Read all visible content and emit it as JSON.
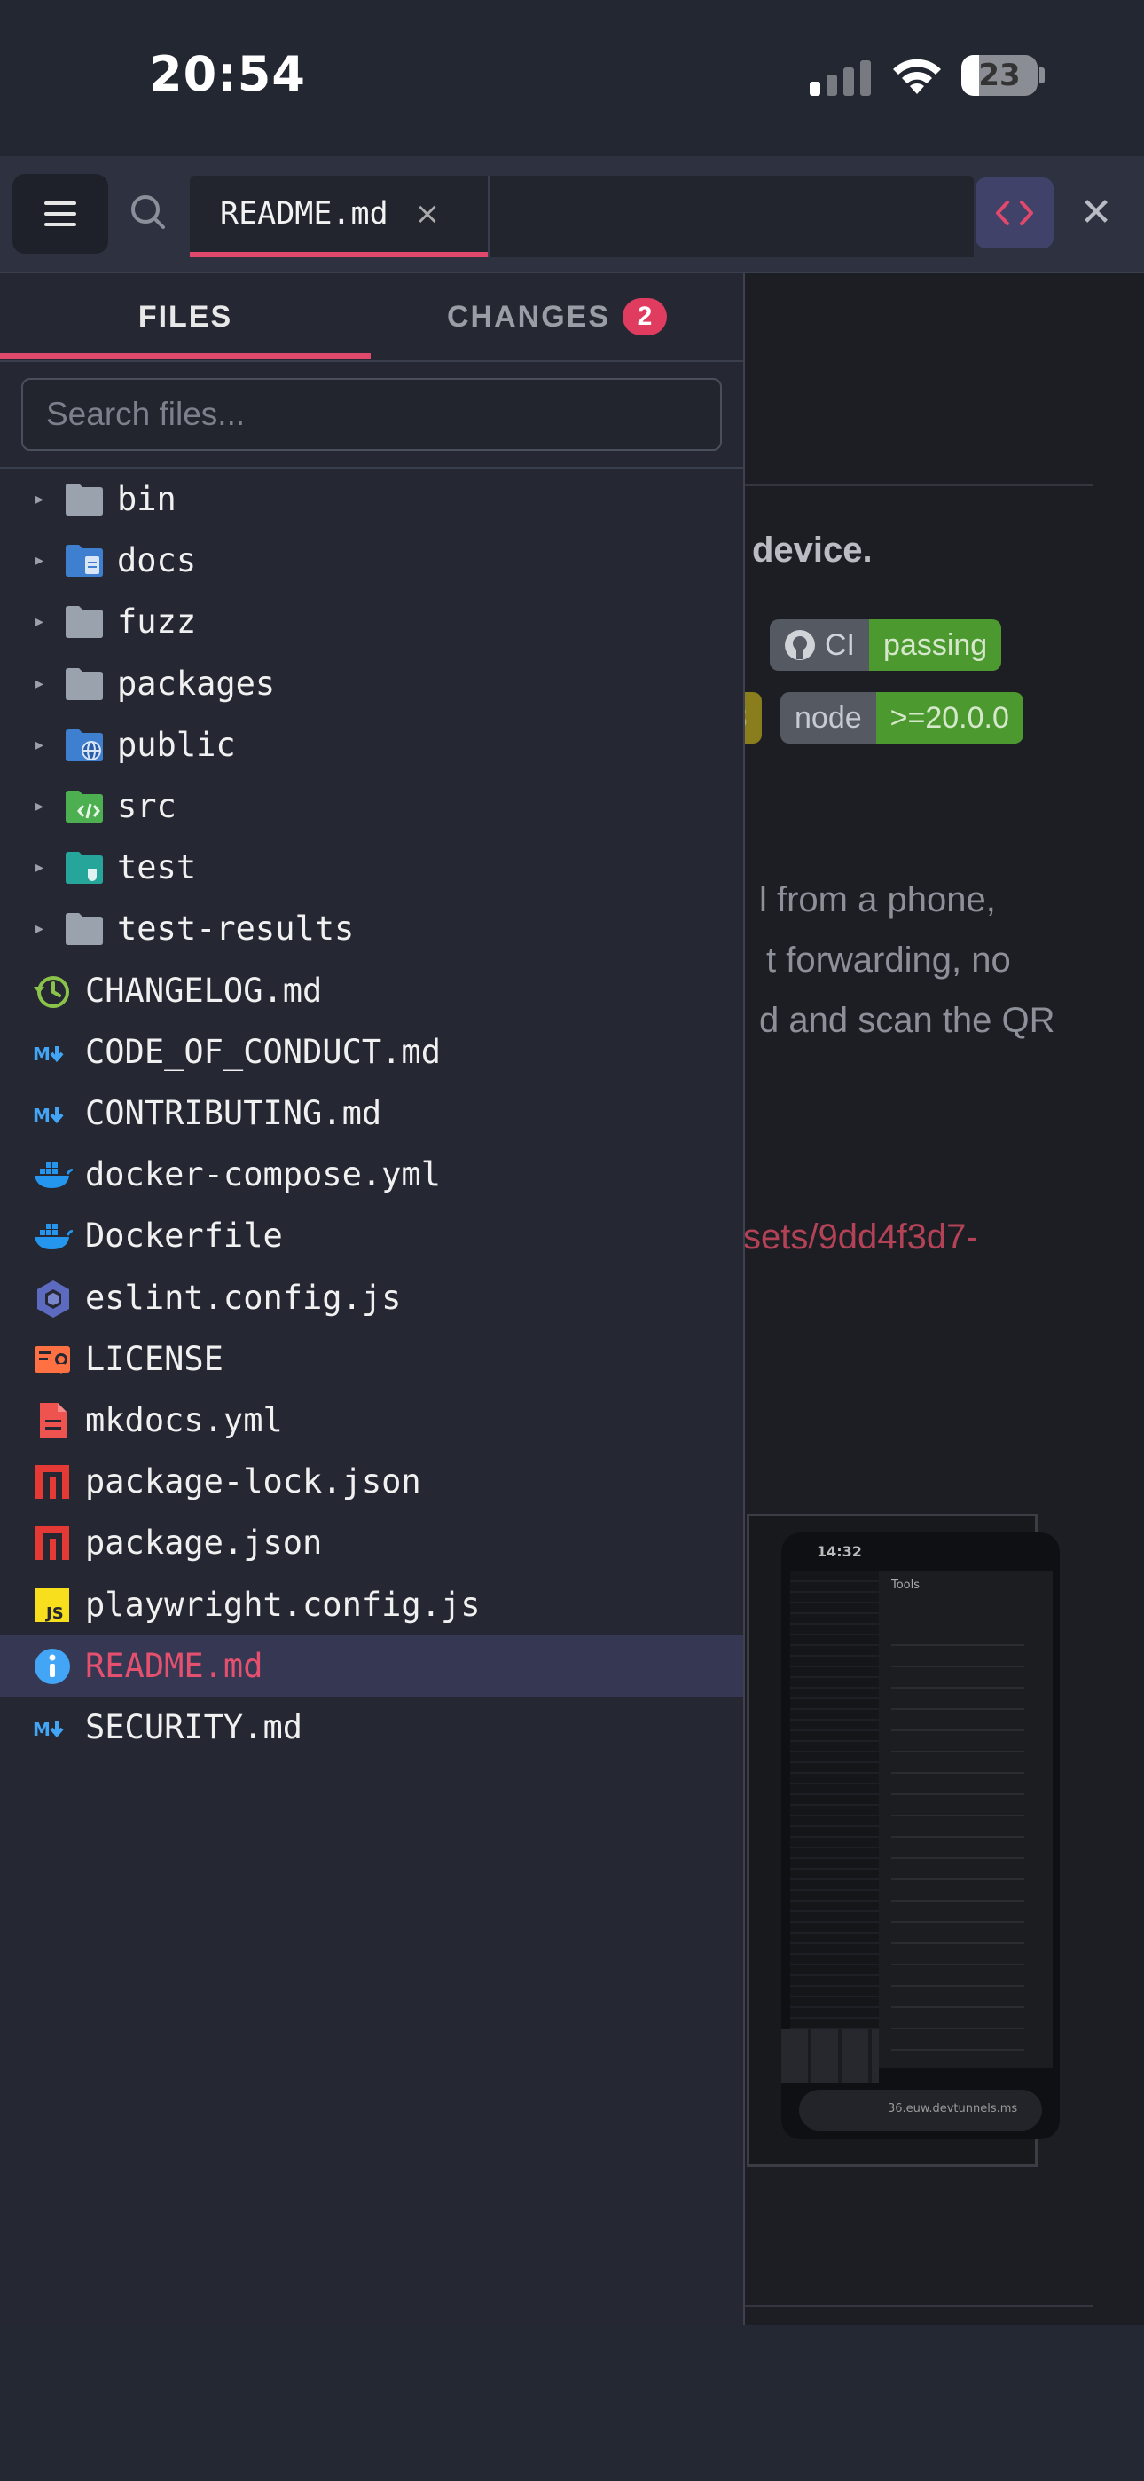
{
  "status_bar": {
    "time": "20:54",
    "battery_level": "23",
    "battery_fraction": 0.23
  },
  "tab_bar": {
    "active_tab": "README.md",
    "close_symbol": "×",
    "close_panel_symbol": "✕"
  },
  "sidebar": {
    "tabs": [
      {
        "label": "FILES",
        "active": true
      },
      {
        "label": "CHANGES",
        "count": "2",
        "active": false
      }
    ],
    "search_placeholder": "Search files...",
    "folders": [
      {
        "name": "bin",
        "icon": "folder-icon"
      },
      {
        "name": "docs",
        "icon": "folder-docs-icon"
      },
      {
        "name": "fuzz",
        "icon": "folder-icon"
      },
      {
        "name": "packages",
        "icon": "folder-icon"
      },
      {
        "name": "public",
        "icon": "folder-public-icon"
      },
      {
        "name": "src",
        "icon": "folder-src-icon"
      },
      {
        "name": "test",
        "icon": "folder-test-icon"
      },
      {
        "name": "test-results",
        "icon": "folder-icon"
      }
    ],
    "files": [
      {
        "name": "CHANGELOG.md",
        "icon": "changelog-icon"
      },
      {
        "name": "CODE_OF_CONDUCT.md",
        "icon": "markdown-icon"
      },
      {
        "name": "CONTRIBUTING.md",
        "icon": "markdown-icon"
      },
      {
        "name": "docker-compose.yml",
        "icon": "docker-icon"
      },
      {
        "name": "Dockerfile",
        "icon": "docker-icon"
      },
      {
        "name": "eslint.config.js",
        "icon": "eslint-icon"
      },
      {
        "name": "LICENSE",
        "icon": "license-icon"
      },
      {
        "name": "mkdocs.yml",
        "icon": "document-icon"
      },
      {
        "name": "package-lock.json",
        "icon": "npm-icon"
      },
      {
        "name": "package.json",
        "icon": "npm-icon"
      },
      {
        "name": "playwright.config.js",
        "icon": "javascript-icon"
      },
      {
        "name": "README.md",
        "icon": "info-icon",
        "selected": true
      },
      {
        "name": "SECURITY.md",
        "icon": "markdown-icon"
      }
    ]
  },
  "preview": {
    "tagline_fragment": "device.",
    "badges": [
      {
        "label": "CI",
        "value": "passing"
      },
      {
        "label": "node",
        "value": ">=20.0.0"
      }
    ],
    "badge_partial_left": "3",
    "paragraph_lines": [
      "l from a phone,",
      "t forwarding, no",
      "d and scan the QR"
    ],
    "link_fragment": "sets/9dd4f3d7-",
    "screenshot_time": "14:32",
    "screenshot_panel_title": "Tools",
    "screenshot_url": "36.euw.devtunnels.ms"
  },
  "colors": {
    "accent": "#e0496b",
    "badge_green": "#4c9a2f",
    "badge_yellow": "#9a8a22"
  }
}
